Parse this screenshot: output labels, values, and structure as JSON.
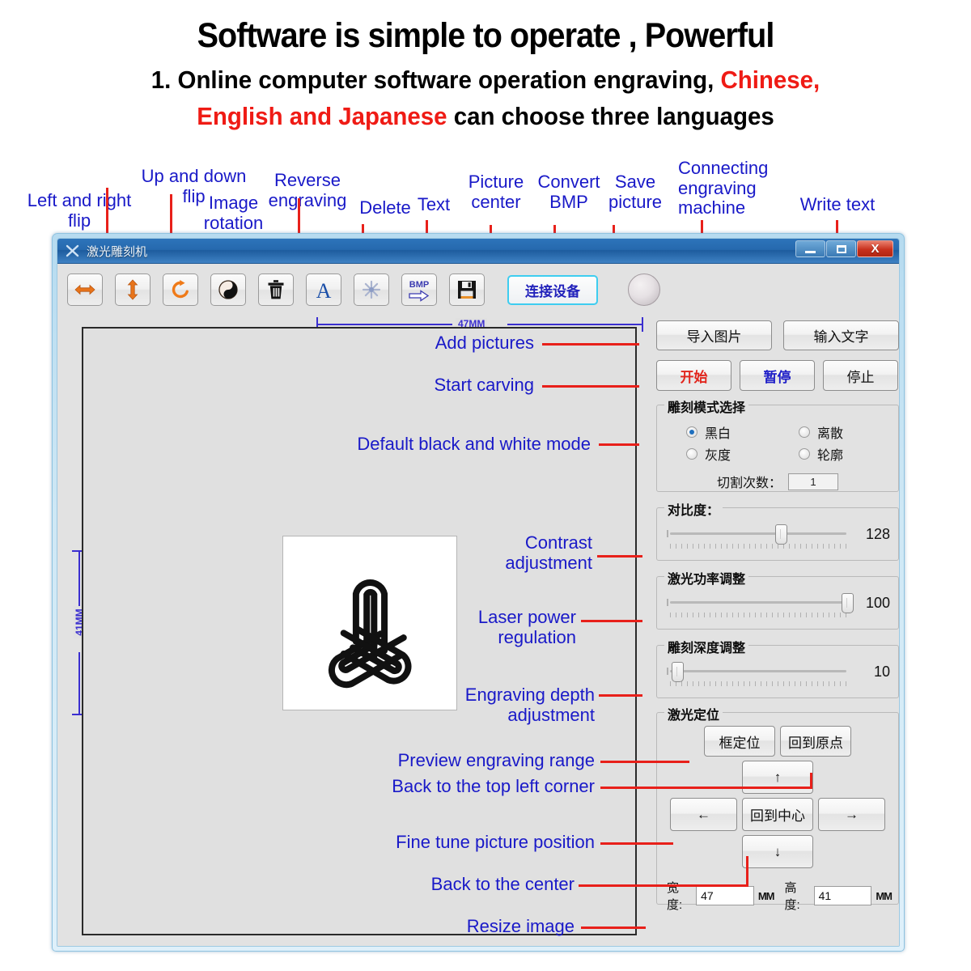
{
  "headline": {
    "title": "Software is simple to operate , Powerful",
    "sub_part1": "1. Online computer software operation engraving, ",
    "sub_red1": "Chinese,",
    "sub_red2": "English and Japanese",
    "sub_part2": " can choose three languages"
  },
  "toolbar_annotations": [
    {
      "label": "Left and right\nflip"
    },
    {
      "label": "Up and down\nflip"
    },
    {
      "label": "Image\nrotation"
    },
    {
      "label": "Reverse\nengraving"
    },
    {
      "label": "Delete"
    },
    {
      "label": "Text"
    },
    {
      "label": "Picture\ncenter"
    },
    {
      "label": "Convert\nBMP"
    },
    {
      "label": "Save\npicture"
    },
    {
      "label": "Connecting\nengraving\nmachine"
    },
    {
      "label": "Write text"
    }
  ],
  "panel_annotations": [
    {
      "label": "Add pictures"
    },
    {
      "label": "Start carving"
    },
    {
      "label": "Default black and white mode"
    },
    {
      "label": "Contrast\nadjustment"
    },
    {
      "label": "Laser power\nregulation"
    },
    {
      "label": "Engraving depth\nadjustment"
    },
    {
      "label": "Preview engraving range"
    },
    {
      "label": "Back to the top left corner"
    },
    {
      "label": "Fine tune picture position"
    },
    {
      "label": "Back to the center"
    },
    {
      "label": "Resize image"
    }
  ],
  "window": {
    "title": "激光雕刻机",
    "close_label": "X",
    "minimize_label": "",
    "maximize_label": ""
  },
  "toolbar": {
    "buttons": [
      {
        "name": "flip-horizontal",
        "title": "左右翻转"
      },
      {
        "name": "flip-vertical",
        "title": "上下翻转"
      },
      {
        "name": "rotate",
        "title": "旋转"
      },
      {
        "name": "invert",
        "title": "反色雕刻"
      },
      {
        "name": "delete",
        "title": "删除"
      },
      {
        "name": "text",
        "title": "文字"
      },
      {
        "name": "center",
        "title": "居中"
      },
      {
        "name": "bmp",
        "title": "转BMP"
      },
      {
        "name": "save",
        "title": "保存"
      }
    ],
    "connect_label": "连接设备"
  },
  "canvas": {
    "width_dim": "47MM",
    "height_dim": "41MM"
  },
  "panel": {
    "import_label": "导入图片",
    "text_label": "输入文字",
    "start_label": "开始",
    "pause_label": "暂停",
    "stop_label": "停止",
    "mode_group_title": "雕刻模式选择",
    "modes": [
      {
        "label": "黑白",
        "selected": true
      },
      {
        "label": "离散",
        "selected": false
      },
      {
        "label": "灰度",
        "selected": false
      },
      {
        "label": "轮廓",
        "selected": false
      }
    ],
    "cut_count_label": "切割次数：",
    "cut_count_value": "1",
    "sliders": [
      {
        "title": "对比度：",
        "value": "128",
        "percent": 50
      },
      {
        "title": "激光功率调整",
        "value": "100",
        "percent": 97
      },
      {
        "title": "雕刻深度调整",
        "value": "10",
        "percent": 8
      }
    ],
    "position_group_title": "激光定位",
    "frame_label": "框定位",
    "origin_label": "回到原点",
    "up_label": "↑",
    "left_label": "←",
    "center_label": "回到中心",
    "right_label": "→",
    "down_label": "↓",
    "width_label": "宽度:",
    "width_value": "47",
    "height_label": "高度:",
    "height_value": "41",
    "unit": "MM"
  },
  "colors": {
    "annotation_blue": "#1919c8",
    "pointer_red": "#e8201a",
    "headline_red": "#ef1b15",
    "dimension_purple": "#3b2fd0",
    "start_red": "#e2251c",
    "pause_blue": "#1d1dc8"
  }
}
